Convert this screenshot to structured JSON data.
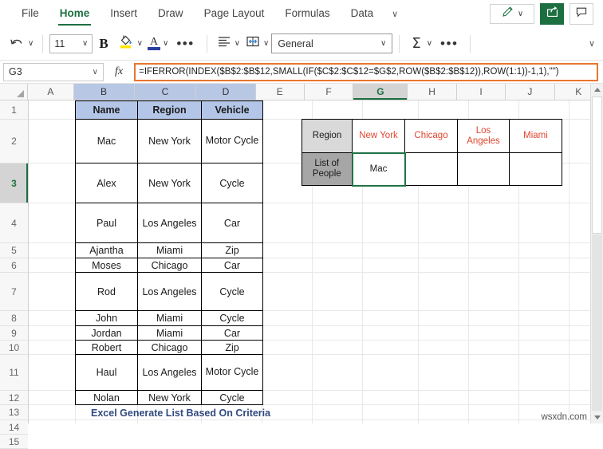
{
  "ribbon": {
    "tabs": [
      {
        "label": "File",
        "active": false
      },
      {
        "label": "Home",
        "active": true
      },
      {
        "label": "Insert",
        "active": false
      },
      {
        "label": "Draw",
        "active": false
      },
      {
        "label": "Page Layout",
        "active": false
      },
      {
        "label": "Formulas",
        "active": false
      },
      {
        "label": "Data",
        "active": false
      }
    ],
    "more_tabs_caret": "∨",
    "pen_caret": "∨",
    "pen_icon": "pencil-icon",
    "share_icon": "share-icon",
    "comment_icon": "comment-icon",
    "collapse_caret": "∨"
  },
  "toolbar": {
    "undo_caret": "∨",
    "font_size": "11",
    "font_size_caret": "∨",
    "bold_label": "B",
    "fill_caret": "∨",
    "fontcolor_letter": "A",
    "fontcolor_caret": "∨",
    "more_font": "•••",
    "align_caret": "∨",
    "merge_caret": "∨",
    "number_format": "General",
    "number_format_caret": "∨",
    "sigma": "Σ",
    "sigma_caret": "∨",
    "more_edit": "•••"
  },
  "formula_bar": {
    "name_box": "G3",
    "name_box_caret": "∨",
    "fx_label": "fx",
    "formula": "=IFERROR(INDEX($B$2:$B$12,SMALL(IF($C$2:$C$12=$G$2,ROW($B$2:$B$12)),ROW(1:1))-1,1),\"\")"
  },
  "grid": {
    "columns": [
      {
        "label": "A",
        "state": "normal"
      },
      {
        "label": "B",
        "state": "ref"
      },
      {
        "label": "C",
        "state": "ref"
      },
      {
        "label": "D",
        "state": "ref"
      },
      {
        "label": "E",
        "state": "normal"
      },
      {
        "label": "F",
        "state": "normal"
      },
      {
        "label": "G",
        "state": "active"
      },
      {
        "label": "H",
        "state": "normal"
      },
      {
        "label": "I",
        "state": "normal"
      },
      {
        "label": "J",
        "state": "normal"
      },
      {
        "label": "K",
        "state": "normal"
      }
    ],
    "rows": [
      {
        "label": "1",
        "active": false
      },
      {
        "label": "2",
        "active": false
      },
      {
        "label": "3",
        "active": true
      },
      {
        "label": "4",
        "active": false
      },
      {
        "label": "5",
        "active": false
      },
      {
        "label": "6",
        "active": false
      },
      {
        "label": "7",
        "active": false
      },
      {
        "label": "8",
        "active": false
      },
      {
        "label": "9",
        "active": false
      },
      {
        "label": "10",
        "active": false
      },
      {
        "label": "11",
        "active": false
      },
      {
        "label": "12",
        "active": false
      },
      {
        "label": "13",
        "active": false
      },
      {
        "label": "14",
        "active": false
      },
      {
        "label": "15",
        "active": false
      }
    ]
  },
  "data_table": {
    "headers": [
      "Name",
      "Region",
      "Vehicle"
    ],
    "rows": [
      [
        "Mac",
        "New York",
        "Motor Cycle"
      ],
      [
        "Alex",
        "New York",
        "Cycle"
      ],
      [
        "Paul",
        "Los Angeles",
        "Car"
      ],
      [
        "Ajantha",
        "Miami",
        "Zip"
      ],
      [
        "Moses",
        "Chicago",
        "Car"
      ],
      [
        "Rod",
        "Los Angeles",
        "Cycle"
      ],
      [
        "John",
        "Miami",
        "Cycle"
      ],
      [
        "Jordan",
        "Miami",
        "Car"
      ],
      [
        "Robert",
        "Chicago",
        "Zip"
      ],
      [
        "Haul",
        "Los Angeles",
        "Motor Cycle"
      ],
      [
        "Nolan",
        "New York",
        "Cycle"
      ]
    ]
  },
  "result_table": {
    "row1_label": "Region",
    "row2_label": "List of People",
    "regions": [
      "New York",
      "Chicago",
      "Los Angeles",
      "Miami"
    ],
    "values": [
      "Mac",
      "",
      "",
      ""
    ]
  },
  "caption": "Excel Generate List Based On Criteria",
  "watermark": "wsxdn.com",
  "colors": {
    "accent_green": "#1d6f42",
    "formula_border": "#e8762c",
    "header_blue": "#b4c6e7",
    "region_red": "#e0462e",
    "label_light": "#d9d9d9",
    "label_dark": "#a6a6a6",
    "caption_blue": "#31497e"
  }
}
